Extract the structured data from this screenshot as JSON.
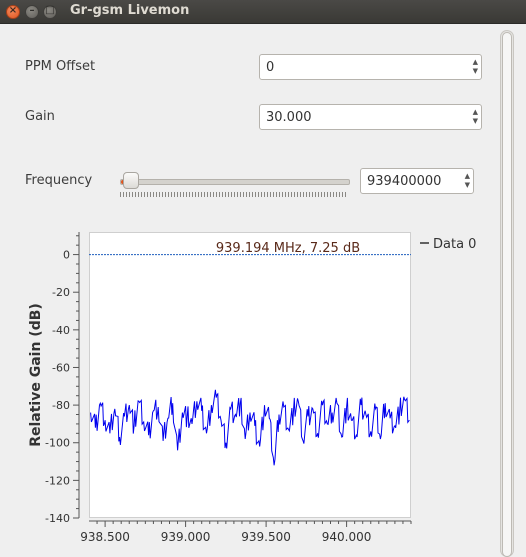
{
  "window": {
    "title": "Gr-gsm Livemon",
    "close_glyph": "×",
    "min_glyph": "–",
    "max_glyph": "□"
  },
  "controls": {
    "ppm": {
      "label": "PPM Offset",
      "value": "0"
    },
    "gain": {
      "label": "Gain",
      "value": "30.000"
    },
    "frequency": {
      "label": "Frequency",
      "value": "939400000",
      "slider_fraction": 0.03
    }
  },
  "icons": {
    "spin_up": "▲",
    "spin_down": "▼"
  },
  "chart_data": {
    "type": "line",
    "ylabel": "Relative Gain (dB)",
    "xlabel": "",
    "xlim": [
      938.4,
      940.4
    ],
    "ylim": [
      -140,
      12
    ],
    "x_ticks": [
      938.5,
      939.0,
      939.5,
      940.0
    ],
    "x_tick_labels": [
      "938.500",
      "939.000",
      "939.500",
      "940.000"
    ],
    "y_ticks": [
      0,
      -20,
      -40,
      -60,
      -80,
      -100,
      -120,
      -140
    ],
    "y_tick_labels": [
      "0",
      "-20",
      "-40",
      "-60",
      "-80",
      "-100",
      "-120",
      "-140"
    ],
    "annotation": "939.194 MHz, 7.25 dB",
    "reference_level": 0,
    "legend": "Data 0",
    "legend_position": "right",
    "series": [
      {
        "name": "Data 0",
        "color": "#0000ee",
        "x": [
          938.41,
          938.44,
          938.47,
          938.5,
          938.53,
          938.56,
          938.59,
          938.62,
          938.65,
          938.68,
          938.71,
          938.74,
          938.77,
          938.8,
          938.83,
          938.86,
          938.89,
          938.92,
          938.95,
          938.98,
          939.01,
          939.04,
          939.07,
          939.1,
          939.13,
          939.16,
          939.19,
          939.22,
          939.25,
          939.28,
          939.31,
          939.34,
          939.37,
          939.4,
          939.43,
          939.46,
          939.49,
          939.52,
          939.55,
          939.58,
          939.61,
          939.64,
          939.67,
          939.7,
          939.73,
          939.76,
          939.79,
          939.82,
          939.85,
          939.88,
          939.91,
          939.94,
          939.97,
          940.0,
          940.03,
          940.06,
          940.09,
          940.12,
          940.15,
          940.18,
          940.21,
          940.24,
          940.27,
          940.3,
          940.33,
          940.36,
          940.39
        ],
        "y": [
          -84,
          -92,
          -79,
          -88,
          -95,
          -82,
          -97,
          -86,
          -80,
          -91,
          -78,
          -89,
          -96,
          -83,
          -81,
          -99,
          -87,
          -79,
          -104,
          -84,
          -86,
          -90,
          -78,
          -83,
          -95,
          -80,
          -76,
          -88,
          -100,
          -82,
          -85,
          -79,
          -98,
          -84,
          -91,
          -102,
          -80,
          -87,
          -112,
          -85,
          -81,
          -93,
          -83,
          -78,
          -99,
          -86,
          -82,
          -95,
          -80,
          -90,
          -84,
          -79,
          -97,
          -81,
          -88,
          -96,
          -80,
          -85,
          -94,
          -82,
          -98,
          -79,
          -87,
          -91,
          -83,
          -77,
          -88
        ]
      }
    ]
  }
}
